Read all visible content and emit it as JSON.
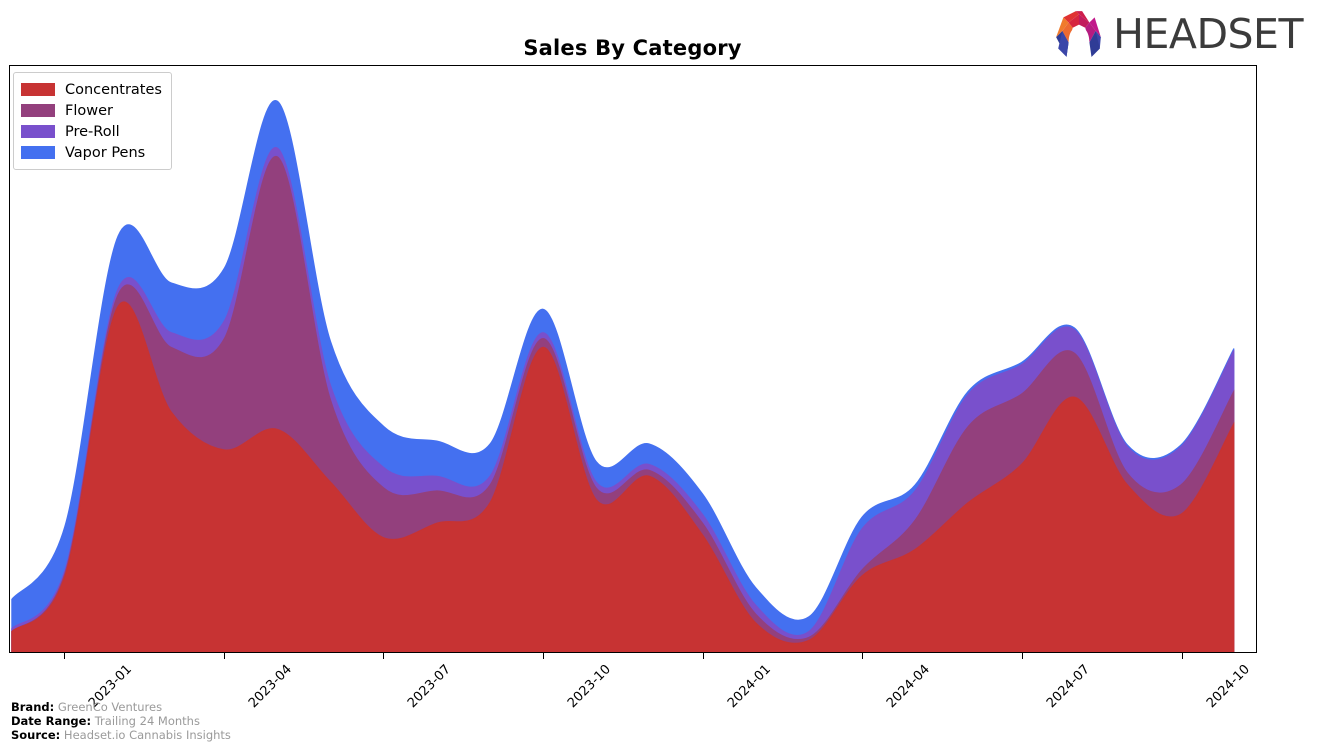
{
  "header": {
    "title": "Sales By Category",
    "logo_word": "HEADSET",
    "logo_icon": "headset-arch-logo"
  },
  "legend": {
    "position": "top-left",
    "items": [
      {
        "label": "Concentrates",
        "color": "#C73333"
      },
      {
        "label": "Flower",
        "color": "#93407D"
      },
      {
        "label": "Pre-Roll",
        "color": "#7950CC"
      },
      {
        "label": "Vapor Pens",
        "color": "#4470F0"
      }
    ]
  },
  "footer": {
    "rows": [
      {
        "key": "Brand:",
        "value": "GreenCo Ventures"
      },
      {
        "key": "Date Range:",
        "value": "Trailing 24 Months"
      },
      {
        "key": "Source:",
        "value": "Headset.io Cannabis Insights"
      }
    ]
  },
  "chart_data": {
    "type": "area",
    "stacked": true,
    "title": "Sales By Category",
    "xlabel": "",
    "ylabel": "",
    "grid": false,
    "legend_position": "top-left",
    "x_tick_labels": [
      "2023-01",
      "2023-04",
      "2023-07",
      "2023-10",
      "2024-01",
      "2024-04",
      "2024-07",
      "2024-10"
    ],
    "x_tick_months": [
      "2023-01",
      "2023-04",
      "2023-07",
      "2023-10",
      "2024-01",
      "2024-04",
      "2024-07",
      "2024-10"
    ],
    "x": [
      "2022-12",
      "2023-01",
      "2023-02",
      "2023-03",
      "2023-04",
      "2023-05",
      "2023-06",
      "2023-07",
      "2023-08",
      "2023-09",
      "2023-10",
      "2023-11",
      "2023-12",
      "2024-01",
      "2024-02",
      "2024-03",
      "2024-04",
      "2024-05",
      "2024-06",
      "2024-07",
      "2024-08",
      "2024-09",
      "2024-10",
      "2024-11"
    ],
    "ylim": [
      0,
      100
    ],
    "series": [
      {
        "name": "Concentrates",
        "color": "#C73333",
        "values": [
          3.5,
          13.0,
          59.0,
          41.0,
          34.5,
          38.0,
          29.0,
          19.5,
          22.0,
          25.5,
          52.0,
          26.0,
          30.0,
          20.0,
          5.0,
          2.0,
          13.0,
          17.5,
          25.5,
          32.0,
          43.5,
          28.5,
          23.5,
          39.0
        ]
      },
      {
        "name": "Flower",
        "color": "#93407D",
        "values": [
          0.0,
          0.5,
          2.0,
          11.0,
          19.0,
          46.5,
          14.0,
          8.5,
          5.5,
          3.0,
          1.5,
          2.0,
          1.0,
          2.0,
          1.5,
          0.5,
          1.0,
          5.0,
          13.0,
          12.0,
          7.5,
          2.0,
          5.0,
          5.5
        ]
      },
      {
        "name": "Pre-Roll",
        "color": "#7950CC",
        "values": [
          0.5,
          0.5,
          1.0,
          2.5,
          3.0,
          1.5,
          2.5,
          3.5,
          2.5,
          1.5,
          1.0,
          1.0,
          1.0,
          1.5,
          1.5,
          1.0,
          7.0,
          5.0,
          5.5,
          5.0,
          4.0,
          4.5,
          6.5,
          7.0
        ]
      },
      {
        "name": "Vapor Pens",
        "color": "#4470F0",
        "values": [
          5.0,
          7.5,
          9.0,
          8.5,
          9.0,
          8.0,
          7.5,
          7.0,
          6.0,
          5.5,
          4.0,
          3.5,
          3.5,
          3.5,
          3.0,
          2.5,
          2.0,
          1.0,
          0.5,
          0.4,
          0.3,
          0.3,
          0.3,
          0.3
        ]
      }
    ]
  }
}
